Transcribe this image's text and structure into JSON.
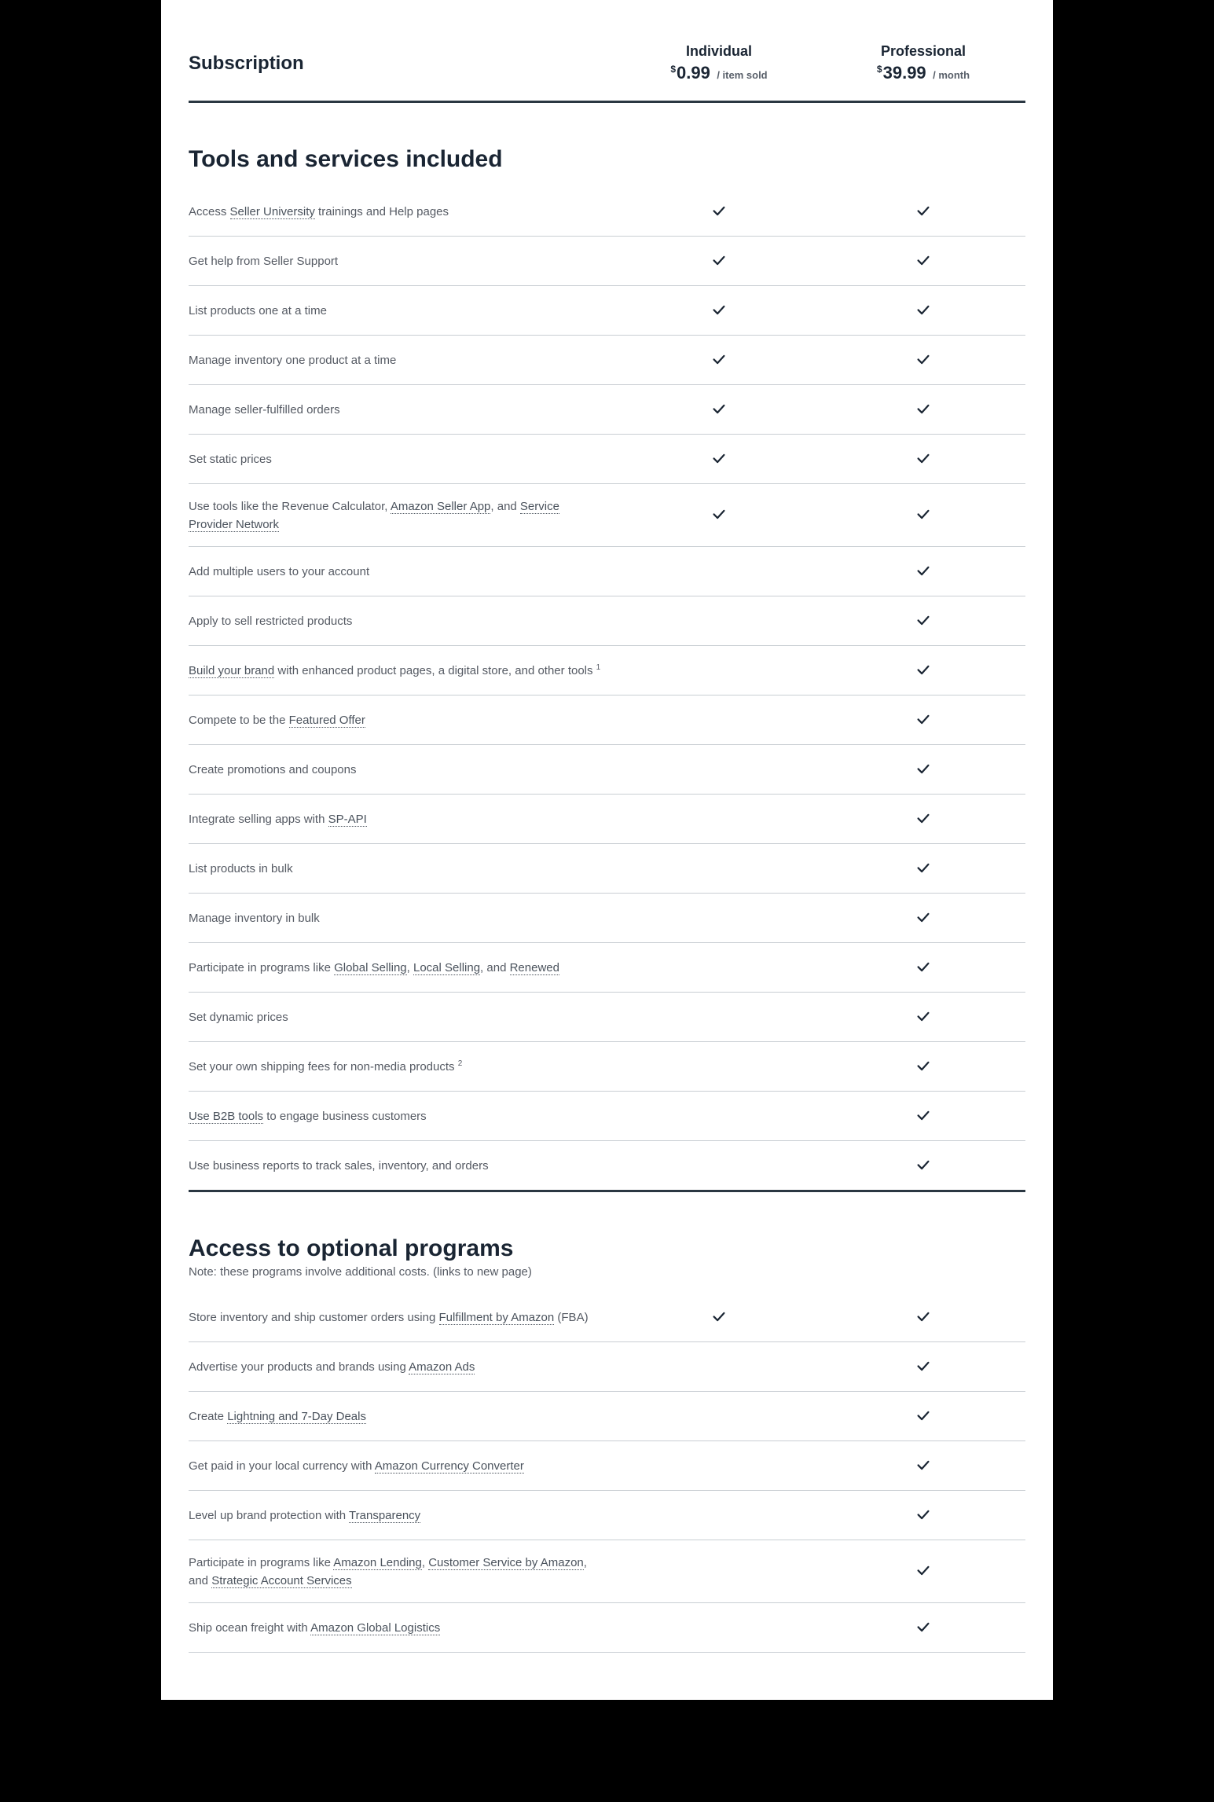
{
  "header": {
    "subscription_label": "Subscription",
    "plan_individual": {
      "name": "Individual",
      "currency": "$",
      "price": "0.99",
      "unit": "/ item sold"
    },
    "plan_professional": {
      "name": "Professional",
      "currency": "$",
      "price": "39.99",
      "unit": "/ month"
    }
  },
  "sections": [
    {
      "title": "Tools and services included",
      "note": "",
      "rows": [
        {
          "parts": [
            {
              "t": "Access "
            },
            {
              "t": "Seller University",
              "link": true
            },
            {
              "t": " trainings and Help pages"
            }
          ],
          "individual": true,
          "professional": true
        },
        {
          "parts": [
            {
              "t": "Get help from Seller Support"
            }
          ],
          "individual": true,
          "professional": true
        },
        {
          "parts": [
            {
              "t": "List products one at a time"
            }
          ],
          "individual": true,
          "professional": true
        },
        {
          "parts": [
            {
              "t": "Manage inventory one product at a time"
            }
          ],
          "individual": true,
          "professional": true
        },
        {
          "parts": [
            {
              "t": "Manage seller-fulfilled orders"
            }
          ],
          "individual": true,
          "professional": true
        },
        {
          "parts": [
            {
              "t": "Set static prices"
            }
          ],
          "individual": true,
          "professional": true
        },
        {
          "parts": [
            {
              "t": "Use tools like the Revenue Calculator, "
            },
            {
              "t": "Amazon Seller App",
              "link": true
            },
            {
              "t": ", and "
            },
            {
              "t": "Service Provider Network",
              "link": true
            }
          ],
          "individual": true,
          "professional": true
        },
        {
          "parts": [
            {
              "t": "Add multiple users to your account"
            }
          ],
          "individual": false,
          "professional": true
        },
        {
          "parts": [
            {
              "t": "Apply to sell restricted products"
            }
          ],
          "individual": false,
          "professional": true
        },
        {
          "parts": [
            {
              "t": "Build your brand",
              "link": true
            },
            {
              "t": " with enhanced product pages, a digital store, and other tools "
            },
            {
              "t": "1",
              "sup": true
            }
          ],
          "individual": false,
          "professional": true
        },
        {
          "parts": [
            {
              "t": "Compete to be the "
            },
            {
              "t": "Featured Offer",
              "link": true
            }
          ],
          "individual": false,
          "professional": true
        },
        {
          "parts": [
            {
              "t": "Create promotions and coupons"
            }
          ],
          "individual": false,
          "professional": true
        },
        {
          "parts": [
            {
              "t": "Integrate selling apps with "
            },
            {
              "t": "SP-API",
              "link": true
            }
          ],
          "individual": false,
          "professional": true
        },
        {
          "parts": [
            {
              "t": "List products in bulk"
            }
          ],
          "individual": false,
          "professional": true
        },
        {
          "parts": [
            {
              "t": "Manage inventory in bulk"
            }
          ],
          "individual": false,
          "professional": true
        },
        {
          "parts": [
            {
              "t": "Participate in programs like "
            },
            {
              "t": "Global Selling",
              "link": true
            },
            {
              "t": ", "
            },
            {
              "t": "Local Selling",
              "link": true
            },
            {
              "t": ", and "
            },
            {
              "t": "Renewed",
              "link": true
            }
          ],
          "individual": false,
          "professional": true
        },
        {
          "parts": [
            {
              "t": "Set dynamic prices"
            }
          ],
          "individual": false,
          "professional": true
        },
        {
          "parts": [
            {
              "t": "Set your own shipping fees for non-media products "
            },
            {
              "t": "2",
              "sup": true
            }
          ],
          "individual": false,
          "professional": true
        },
        {
          "parts": [
            {
              "t": "Use B2B tools",
              "link": true
            },
            {
              "t": " to engage business customers"
            }
          ],
          "individual": false,
          "professional": true
        },
        {
          "parts": [
            {
              "t": "Use business reports to track sales, inventory, and orders"
            }
          ],
          "individual": false,
          "professional": true
        }
      ]
    },
    {
      "title": "Access to optional programs",
      "note": "Note: these programs involve additional costs. (links to new page)",
      "rows": [
        {
          "parts": [
            {
              "t": "Store inventory and ship customer orders using "
            },
            {
              "t": "Fulfillment by Amazon",
              "link": true
            },
            {
              "t": " (FBA)"
            }
          ],
          "individual": true,
          "professional": true
        },
        {
          "parts": [
            {
              "t": "Advertise your products and brands using "
            },
            {
              "t": "Amazon Ads",
              "link": true
            }
          ],
          "individual": false,
          "professional": true
        },
        {
          "parts": [
            {
              "t": "Create "
            },
            {
              "t": "Lightning and 7-Day Deals",
              "link": true
            }
          ],
          "individual": false,
          "professional": true
        },
        {
          "parts": [
            {
              "t": "Get paid in your local currency with "
            },
            {
              "t": "Amazon Currency Converter",
              "link": true
            }
          ],
          "individual": false,
          "professional": true
        },
        {
          "parts": [
            {
              "t": "Level up brand protection with "
            },
            {
              "t": "Transparency",
              "link": true
            }
          ],
          "individual": false,
          "professional": true
        },
        {
          "parts": [
            {
              "t": "Participate in programs like "
            },
            {
              "t": "Amazon Lending",
              "link": true
            },
            {
              "t": ", "
            },
            {
              "t": "Customer Service by Amazon",
              "link": true
            },
            {
              "t": ", and "
            },
            {
              "t": "Strategic Account Services",
              "link": true
            }
          ],
          "individual": false,
          "professional": true
        },
        {
          "parts": [
            {
              "t": "Ship ocean freight with "
            },
            {
              "t": "Amazon Global Logistics",
              "link": true
            }
          ],
          "individual": false,
          "professional": true
        }
      ]
    }
  ]
}
